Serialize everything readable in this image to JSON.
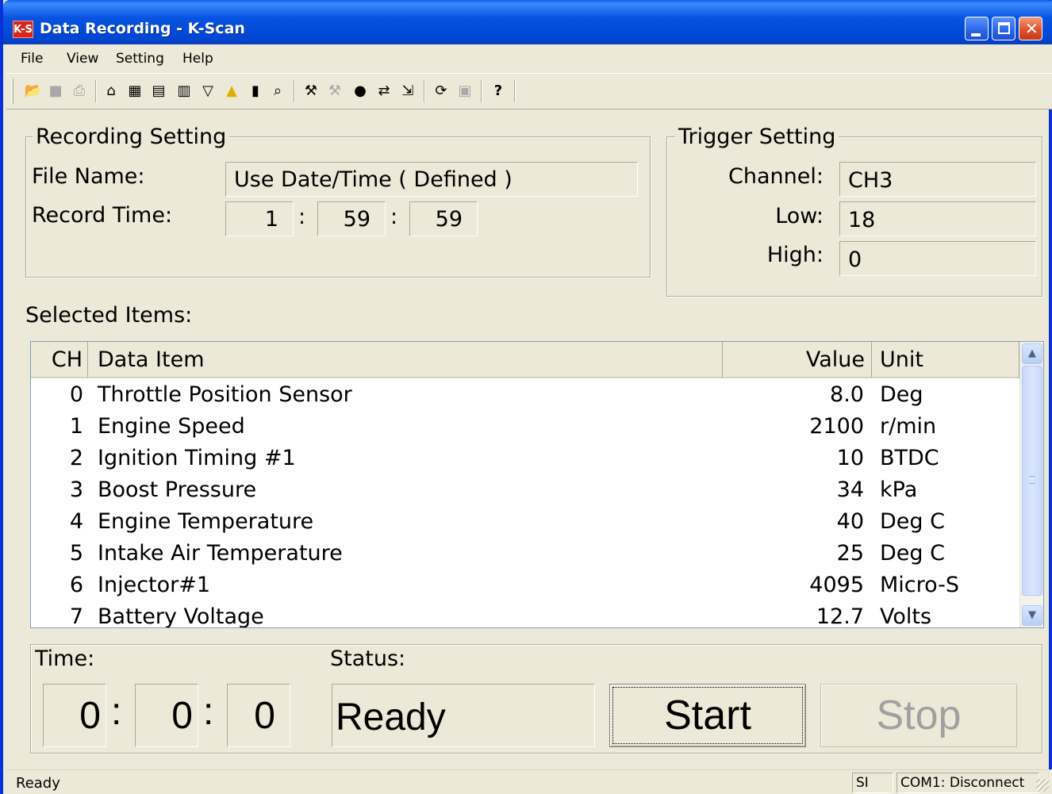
{
  "window": {
    "icon_text": "K-S",
    "title": "Data Recording - K-Scan"
  },
  "menu": {
    "items": [
      {
        "label": "File"
      },
      {
        "label": "View"
      },
      {
        "label": "Setting"
      },
      {
        "label": "Help"
      }
    ]
  },
  "toolbar": {
    "icons": [
      "open-folder-icon",
      "save-icon",
      "print-icon",
      "home-icon",
      "grid-icon",
      "list-icon",
      "bar-chart-icon",
      "filter-icon",
      "warning-icon",
      "report-icon",
      "preview-icon",
      "wrench-icon",
      "tool-disabled-icon",
      "info-icon",
      "compare-icon",
      "export-icon",
      "refresh-icon",
      "window-icon",
      "help-icon"
    ]
  },
  "recording": {
    "group_label": "Recording Setting",
    "file_name_label": "File Name:",
    "file_name_value": "Use Date/Time ( Defined )",
    "record_time_label": "Record Time:",
    "hours": "1",
    "minutes": "59",
    "seconds": "59",
    "sep": ":"
  },
  "trigger": {
    "group_label": "Trigger Setting",
    "channel_label": "Channel:",
    "channel_value": "CH3",
    "low_label": "Low:",
    "low_value": "18",
    "high_label": "High:",
    "high_value": "0"
  },
  "items": {
    "label": "Selected Items:",
    "headers": {
      "ch": "CH",
      "item": "Data Item",
      "value": "Value",
      "unit": "Unit"
    },
    "rows": [
      {
        "ch": "0",
        "item": "Throttle Position Sensor",
        "value": "8.0",
        "unit": "Deg"
      },
      {
        "ch": "1",
        "item": "Engine Speed",
        "value": "2100",
        "unit": "r/min"
      },
      {
        "ch": "2",
        "item": "Ignition Timing #1",
        "value": "10",
        "unit": "BTDC"
      },
      {
        "ch": "3",
        "item": "Boost Pressure",
        "value": "34",
        "unit": "kPa"
      },
      {
        "ch": "4",
        "item": "Engine Temperature",
        "value": "40",
        "unit": "Deg C"
      },
      {
        "ch": "5",
        "item": "Intake Air Temperature",
        "value": "25",
        "unit": "Deg C"
      },
      {
        "ch": "6",
        "item": "Injector#1",
        "value": "4095",
        "unit": "Micro-S"
      },
      {
        "ch": "7",
        "item": "Battery Voltage",
        "value": "12.7",
        "unit": "Volts"
      }
    ]
  },
  "control": {
    "time_label": "Time:",
    "time_h": "0",
    "time_m": "0",
    "time_s": "0",
    "sep": ":",
    "status_label": "Status:",
    "status_value": "Ready",
    "start_label": "Start",
    "stop_label": "Stop"
  },
  "statusbar": {
    "text": "Ready",
    "units": "SI",
    "port": "COM1: Disconnect"
  }
}
